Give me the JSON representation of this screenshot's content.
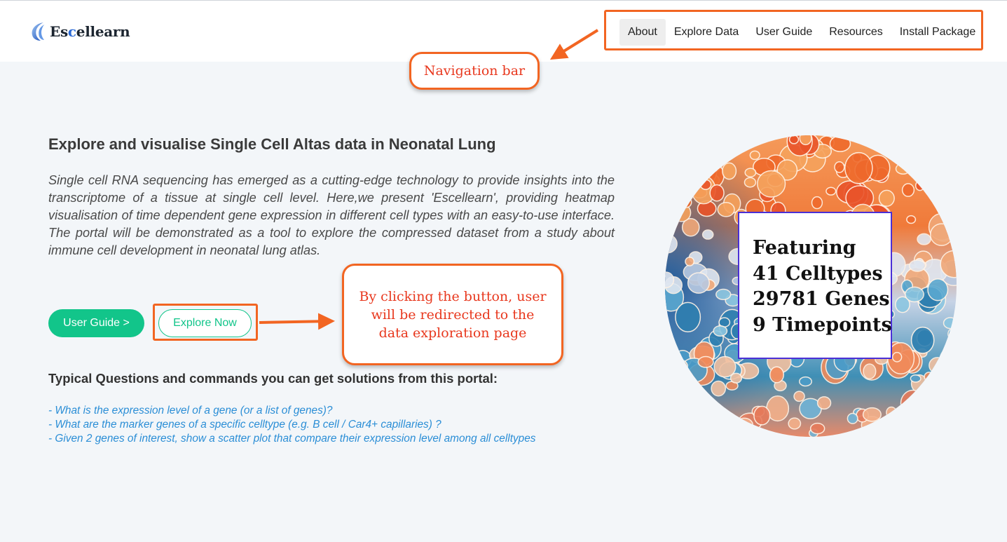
{
  "app": {
    "logo_prefix": "Es",
    "logo_accent": "c",
    "logo_suffix": "ellearn"
  },
  "nav": {
    "items": [
      {
        "label": "About",
        "active": true
      },
      {
        "label": "Explore Data",
        "active": false
      },
      {
        "label": "User Guide",
        "active": false
      },
      {
        "label": "Resources",
        "active": false
      },
      {
        "label": "Install Package",
        "active": false
      }
    ]
  },
  "annotations": {
    "nav_callout": "Navigation bar",
    "button_callout": "By clicking the button, user will be redirected to the data exploration page"
  },
  "main": {
    "headline": "Explore and visualise Single Cell Altas data in Neonatal Lung",
    "intro": "Single cell RNA sequencing has emerged as a cutting-edge technology to provide insights into the transcriptome of a tissue at single cell level. Here,we present 'Escellearn', providing heatmap visualisation of time dependent gene expression in different cell types with an easy-to-use interface. The portal will be demonstrated as a tool to explore the compressed dataset from a study about immune cell development in neonatal lung atlas.",
    "buttons": {
      "user_guide": "User Guide >",
      "explore_now": "Explore Now"
    },
    "questions_title": "Typical Questions and commands you can get solutions from this portal:",
    "questions": [
      "- What is the expression level of a gene (or a list of genes)?",
      "- What are the marker genes of a specific celltype (e.g. B cell / Car4+ capillaries) ?",
      "- Given 2 genes of interest, show a scatter plot that compare their expression level among all celltypes"
    ]
  },
  "feature": {
    "lines": [
      "Featuring",
      "41 Celltypes",
      "29781 Genes",
      "9 Timepoints"
    ]
  },
  "colors": {
    "accent_green": "#12c58a",
    "annotation_orange": "#f26522",
    "link_blue": "#2b8ed6",
    "logo_blue": "#2b6ad6"
  }
}
